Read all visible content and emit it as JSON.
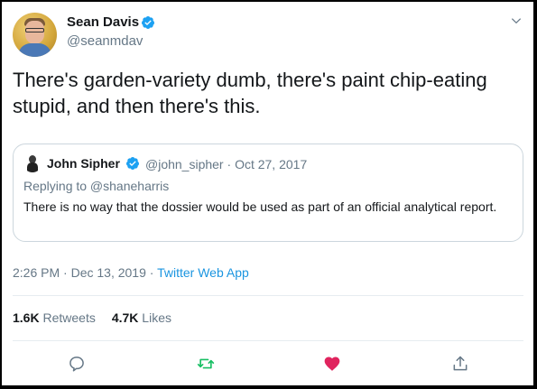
{
  "author": {
    "name": "Sean Davis",
    "handle": "@seanmdav"
  },
  "tweet": {
    "text": "There's garden-variety dumb, there's paint chip-eating stupid, and then there's this."
  },
  "quoted_tweet": {
    "name": "John Sipher",
    "handle": "@john_sipher",
    "separator": "·",
    "date": "Oct 27, 2017",
    "replying_to": "Replying to @shaneharris",
    "text": "There is no way that the dossier would be used as part of an official analytical report."
  },
  "meta": {
    "time": "2:26 PM",
    "separator": "·",
    "date": "Dec 13, 2019",
    "source": "Twitter Web App"
  },
  "stats": {
    "retweets_count": "1.6K",
    "retweets_label": "Retweets",
    "likes_count": "4.7K",
    "likes_label": "Likes"
  },
  "colors": {
    "verified": "#1da1f2",
    "retweet_icon": "#17bf63",
    "like_icon": "#e0245e",
    "link": "#1b95e0",
    "secondary_text": "#657786"
  },
  "icons": [
    "verified-badge-icon",
    "chevron-down-icon",
    "reply-icon",
    "retweet-icon",
    "like-icon",
    "share-icon"
  ]
}
